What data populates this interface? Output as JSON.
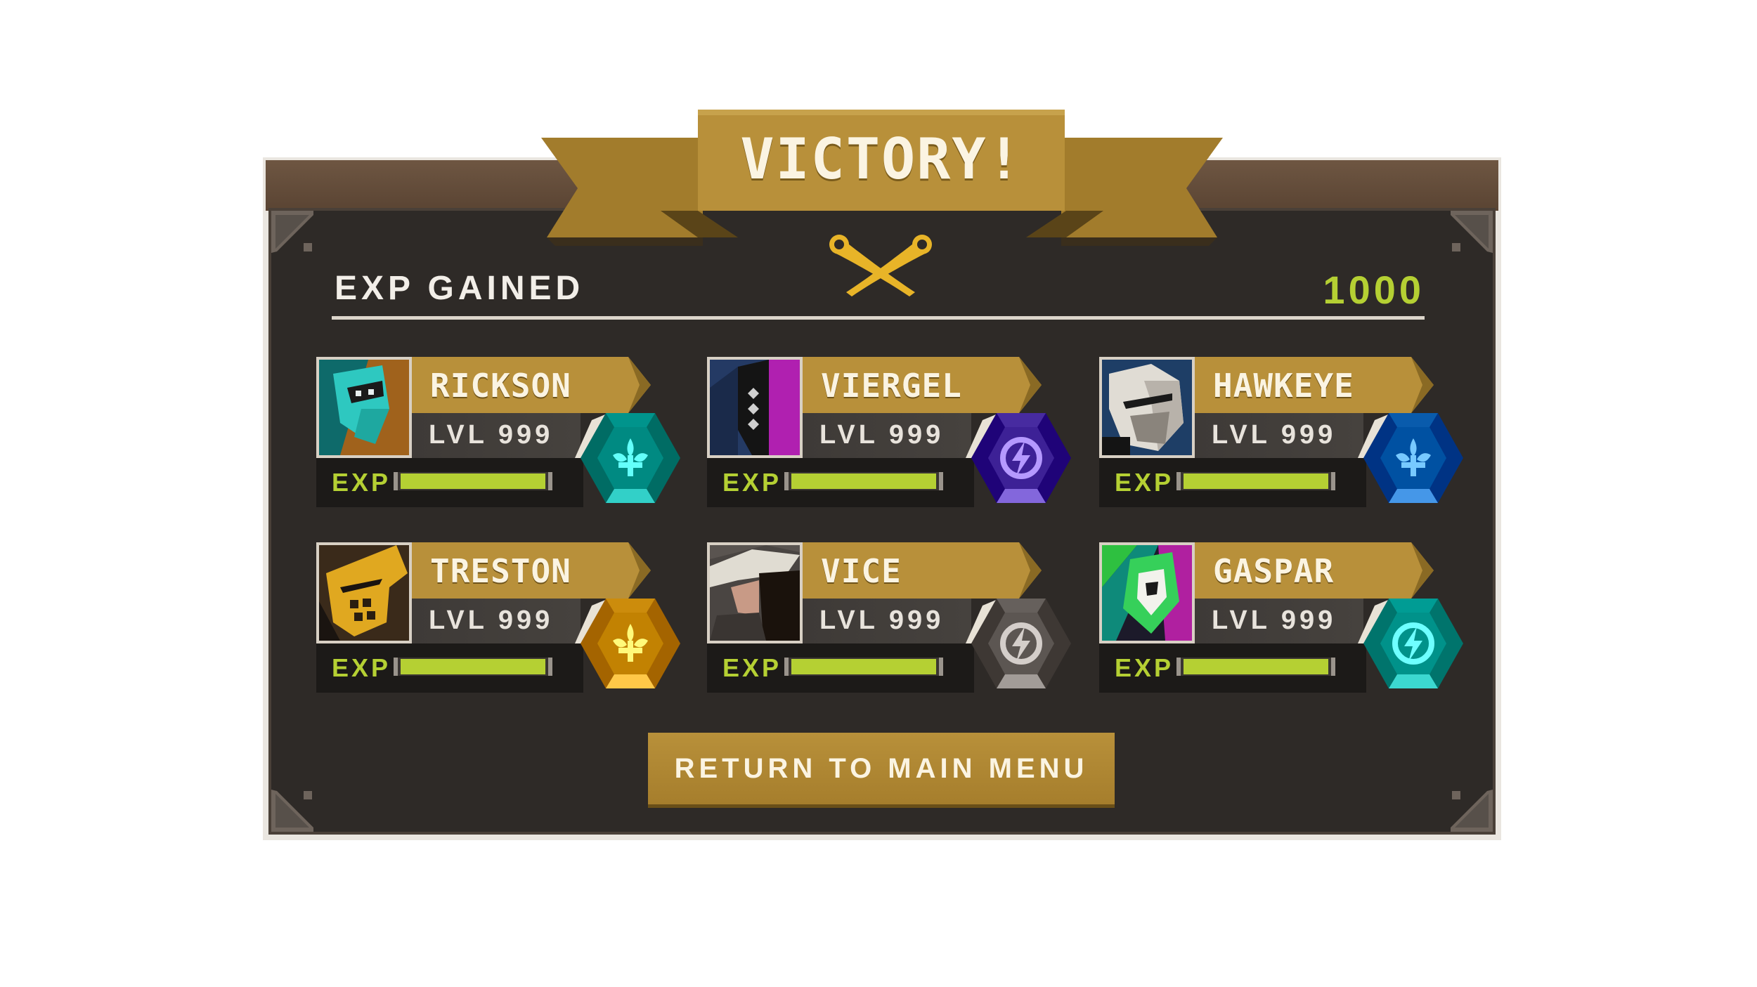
{
  "title": "VICTORY!",
  "header": {
    "exp_gained_label": "EXP GAINED",
    "exp_total": "1000"
  },
  "exp_label": "EXP",
  "heroes": [
    {
      "name": "RICKSON",
      "level": "LVL 999",
      "exp_fill": 1.0,
      "emblem_icon": "fleur-icon",
      "emblem_color": "#0aa8a0",
      "portrait": "teal-knight-portrait"
    },
    {
      "name": "VIERGEL",
      "level": "LVL 999",
      "exp_fill": 1.0,
      "emblem_icon": "lightning-icon",
      "emblem_color": "#5b3fb4",
      "portrait": "purple-rogue-portrait"
    },
    {
      "name": "HAWKEYE",
      "level": "LVL 999",
      "exp_fill": 1.0,
      "emblem_icon": "fleur-icon",
      "emblem_color": "#1d6fc0",
      "portrait": "grey-helm-portrait"
    },
    {
      "name": "TRESTON",
      "level": "LVL 999",
      "exp_fill": 1.0,
      "emblem_icon": "fleur-icon",
      "emblem_color": "#e0a020",
      "portrait": "gold-helm-portrait"
    },
    {
      "name": "VICE",
      "level": "LVL 999",
      "exp_fill": 1.0,
      "emblem_icon": "lightning-icon",
      "emblem_color": "#7a7470",
      "portrait": "hooded-figure-portrait"
    },
    {
      "name": "GASPAR",
      "level": "LVL 999",
      "exp_fill": 1.0,
      "emblem_icon": "lightning-icon",
      "emblem_color": "#14b0a8",
      "portrait": "green-mask-portrait"
    }
  ],
  "footer": {
    "return_label": "RETURN TO MAIN MENU"
  },
  "colors": {
    "gold": "#b8903a",
    "exp_green": "#b5d033",
    "panel": "#2e2a27"
  }
}
